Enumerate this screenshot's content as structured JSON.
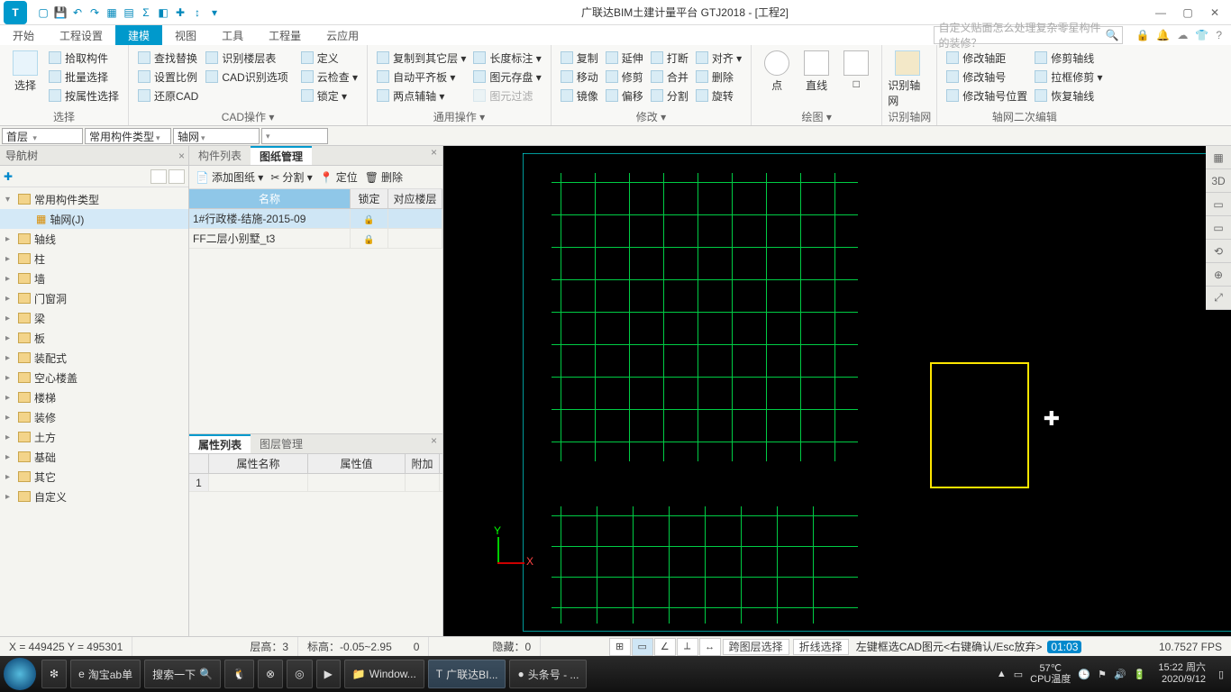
{
  "title": "广联达BIM土建计量平台 GTJ2018 - [工程2]",
  "search_placeholder": "自定义贴面怎么处理复杂零星构件的装修？",
  "menu": [
    "开始",
    "工程设置",
    "建模",
    "视图",
    "工具",
    "工程量",
    "云应用"
  ],
  "menu_active": 2,
  "ribbon": {
    "groups": [
      {
        "label": "选择",
        "big": "选择",
        "cols": [
          [
            "拾取构件",
            "批量选择",
            "按属性选择"
          ]
        ]
      },
      {
        "label": "CAD操作 ▾",
        "cols": [
          [
            "查找替换",
            "设置比例",
            "还原CAD"
          ],
          [
            "识别楼层表",
            "CAD识别选项"
          ],
          [
            "定义",
            "云检查 ▾",
            "锁定 ▾"
          ]
        ]
      },
      {
        "label": "通用操作 ▾",
        "cols": [
          [
            "复制到其它层 ▾",
            "自动平齐板 ▾",
            "两点辅轴 ▾"
          ],
          [
            "长度标注 ▾",
            "图元存盘 ▾",
            "图元过滤"
          ]
        ]
      },
      {
        "label": "修改 ▾",
        "cols": [
          [
            "复制",
            "移动",
            "镜像"
          ],
          [
            "延伸",
            "修剪",
            "偏移"
          ],
          [
            "打断",
            "合并",
            "分割"
          ],
          [
            "对齐 ▾",
            "删除",
            "旋转"
          ]
        ]
      },
      {
        "label": "绘图 ▾",
        "big2": [
          "点",
          "直线",
          "□"
        ]
      },
      {
        "label": "识别轴网",
        "big": "识别轴网"
      },
      {
        "label": "轴网二次编辑",
        "cols": [
          [
            "修改轴距",
            "修改轴号",
            "修改轴号位置"
          ],
          [
            "修剪轴线",
            "拉框修剪 ▾",
            "恢复轴线"
          ]
        ]
      }
    ]
  },
  "context": {
    "floor": "首层",
    "type": "常用构件类型",
    "component": "轴网"
  },
  "nav": {
    "title": "导航树",
    "root": "常用构件类型",
    "child": "轴网(J)",
    "items": [
      "轴线",
      "柱",
      "墙",
      "门窗洞",
      "梁",
      "板",
      "装配式",
      "空心楼盖",
      "楼梯",
      "装修",
      "土方",
      "基础",
      "其它",
      "自定义"
    ]
  },
  "drawings": {
    "tabs": [
      "构件列表",
      "图纸管理"
    ],
    "toolbar": [
      "添加图纸 ▾",
      "分割 ▾",
      "定位",
      "删除"
    ],
    "cols": [
      "名称",
      "锁定",
      "对应楼层"
    ],
    "rows": [
      {
        "name": "1#行政楼-结施-2015-09",
        "locked": true
      },
      {
        "name": "FF二层小别墅_t3",
        "locked": true
      }
    ]
  },
  "props": {
    "tabs": [
      "属性列表",
      "图层管理"
    ],
    "cols": [
      "",
      "属性名称",
      "属性值",
      "附加"
    ]
  },
  "status": {
    "coords": "X = 449425 Y = 495301",
    "floor_h": "层高：3",
    "elev": "标高：-0.05~2.95",
    "hidden": "隐藏：0",
    "btns": [
      "跨图层选择",
      "折线选择"
    ],
    "tip": "左键框选CAD图元<右键确认/Esc放弃>",
    "timer": "01:03",
    "fps": "10.7527 FPS"
  },
  "taskbar": {
    "items": [
      "淘宝ab单",
      "搜索一下",
      "",
      "",
      "",
      "",
      "",
      "Window...",
      "广联达BI...",
      "头条号 - ..."
    ],
    "active": 8,
    "temp": "57℃",
    "temp_label": "CPU温度",
    "time": "15:22",
    "day": "周六",
    "date": "2020/9/12"
  }
}
